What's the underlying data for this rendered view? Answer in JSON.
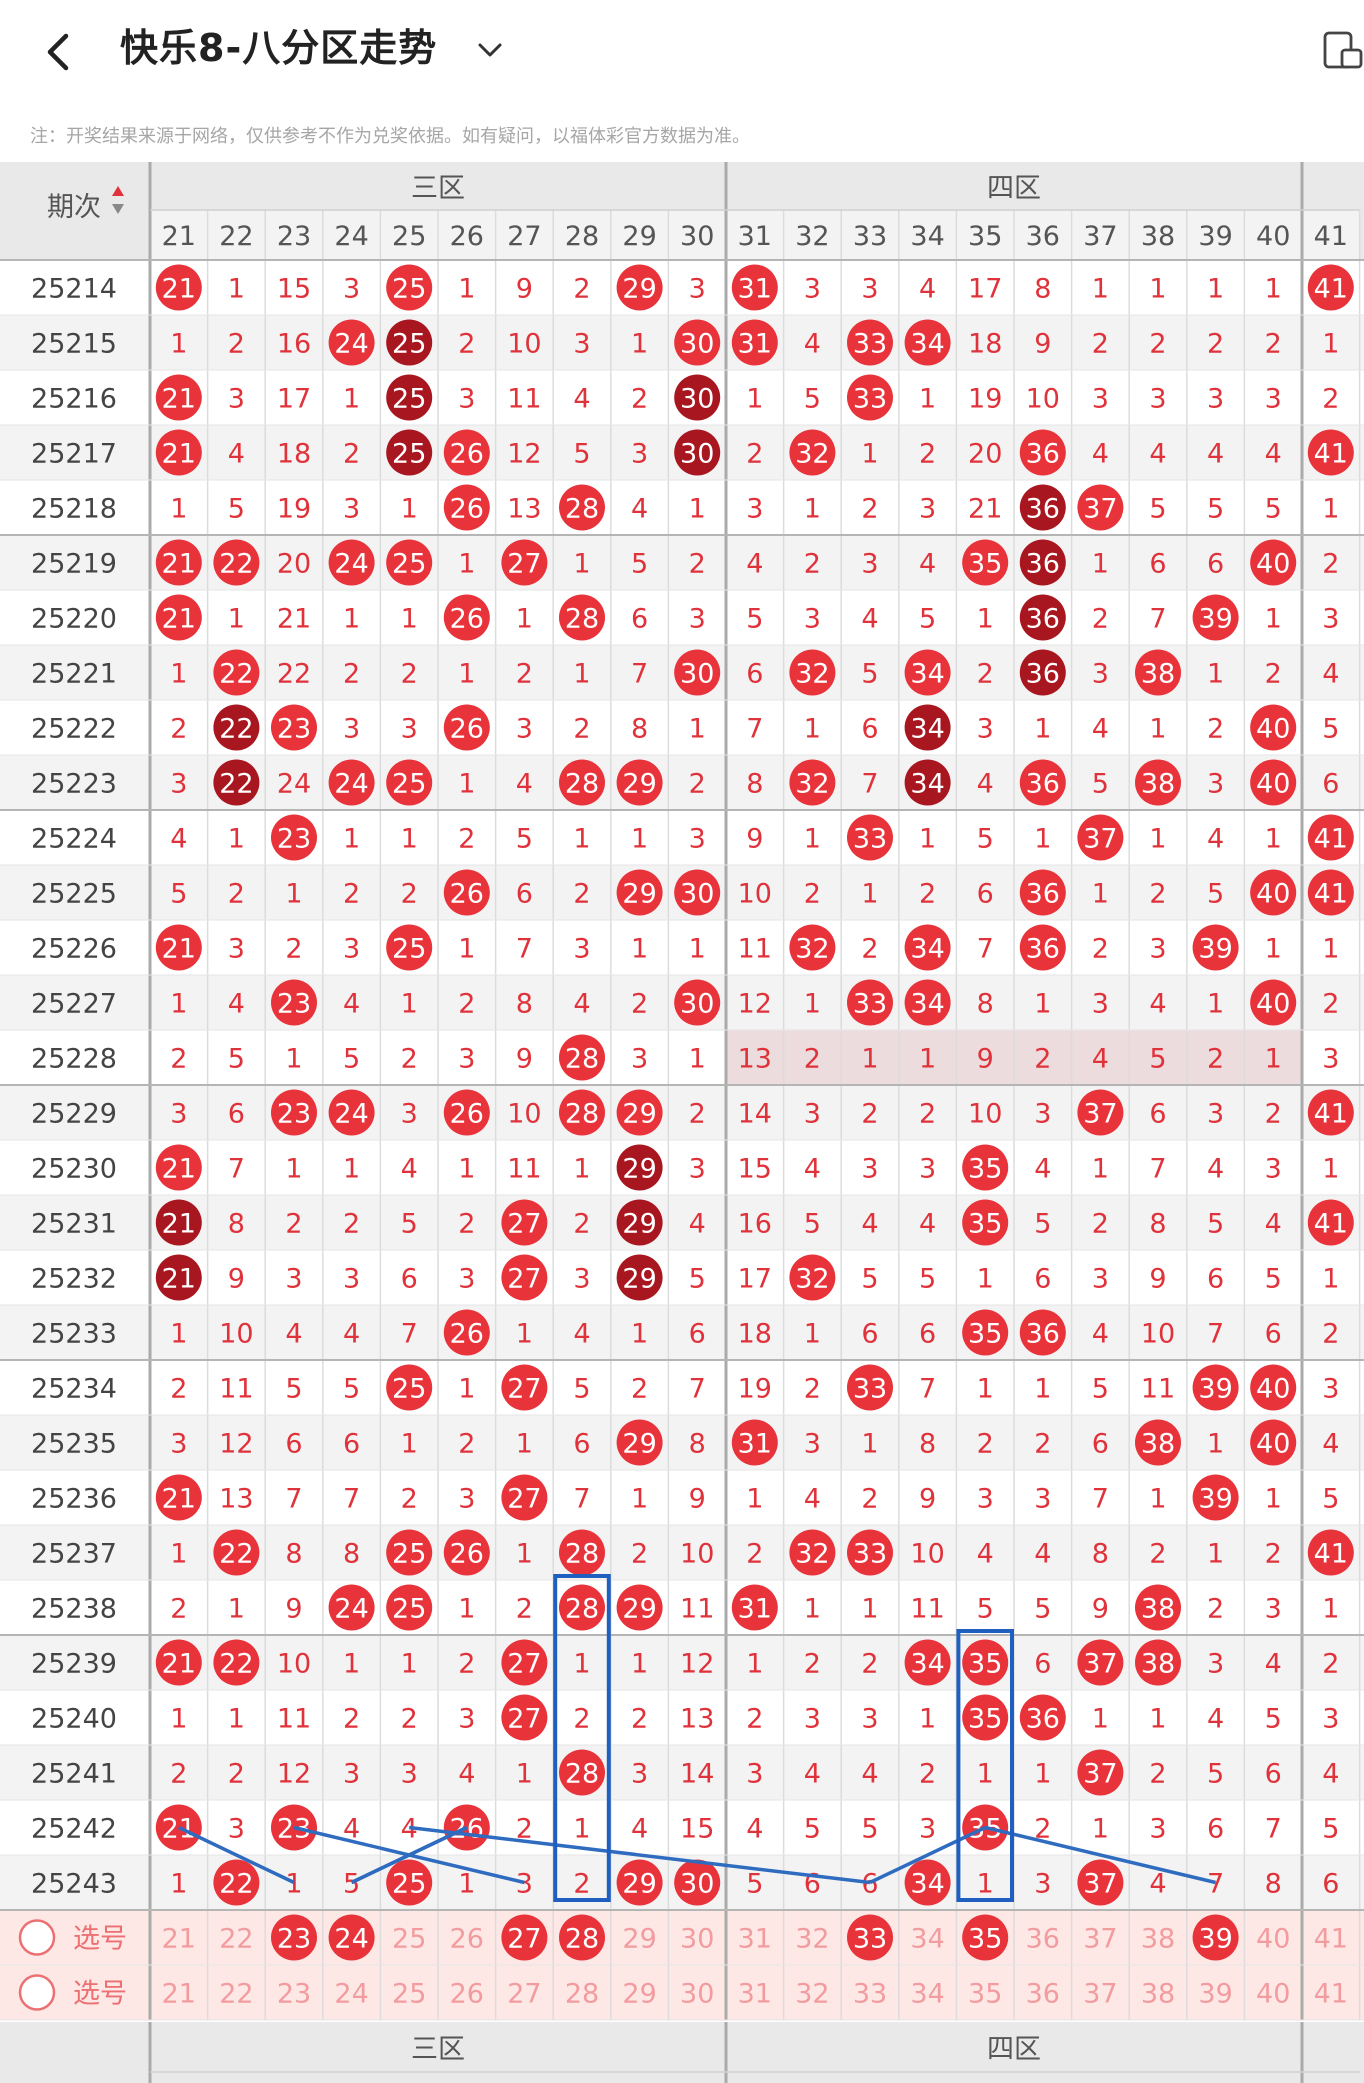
{
  "header": {
    "title": "快乐8-八分区走势",
    "note": "注：开奖结果来源于网络，仅供参考不作为兑奖依据。如有疑问，以福体彩官方数据为准。"
  },
  "table": {
    "issue_label": "期次",
    "zones": [
      {
        "name": "三区",
        "first": 21,
        "last": 30
      },
      {
        "name": "四区",
        "first": 31,
        "last": 40
      }
    ],
    "columns": [
      "21",
      "22",
      "23",
      "24",
      "25",
      "26",
      "27",
      "28",
      "29",
      "30",
      "31",
      "32",
      "33",
      "34",
      "35",
      "36",
      "37",
      "38",
      "39",
      "40",
      "41"
    ],
    "rows": [
      {
        "issue": "25214",
        "cells": [
          "21",
          "1",
          "15",
          "3",
          "25",
          "1",
          "9",
          "2",
          "29",
          "3",
          "31",
          "3",
          "3",
          "4",
          "17",
          "8",
          "1",
          "1",
          "1",
          "1",
          "41"
        ]
      },
      {
        "issue": "25215",
        "cells": [
          "1",
          "2",
          "16",
          "24",
          "25",
          "2",
          "10",
          "3",
          "1",
          "30",
          "31",
          "4",
          "33",
          "34",
          "18",
          "9",
          "2",
          "2",
          "2",
          "2",
          "1"
        ]
      },
      {
        "issue": "25216",
        "cells": [
          "21",
          "3",
          "17",
          "1",
          "25",
          "3",
          "11",
          "4",
          "2",
          "30",
          "1",
          "5",
          "33",
          "1",
          "19",
          "10",
          "3",
          "3",
          "3",
          "3",
          "2"
        ]
      },
      {
        "issue": "25217",
        "cells": [
          "21",
          "4",
          "18",
          "2",
          "25",
          "26",
          "12",
          "5",
          "3",
          "30",
          "2",
          "32",
          "1",
          "2",
          "20",
          "36",
          "4",
          "4",
          "4",
          "4",
          "41"
        ]
      },
      {
        "issue": "25218",
        "cells": [
          "1",
          "5",
          "19",
          "3",
          "1",
          "26",
          "13",
          "28",
          "4",
          "1",
          "3",
          "1",
          "2",
          "3",
          "21",
          "36",
          "37",
          "5",
          "5",
          "5",
          "1"
        ]
      },
      {
        "issue": "25219",
        "cells": [
          "21",
          "22",
          "20",
          "24",
          "25",
          "1",
          "27",
          "1",
          "5",
          "2",
          "4",
          "2",
          "3",
          "4",
          "35",
          "36",
          "1",
          "6",
          "6",
          "40",
          "2"
        ]
      },
      {
        "issue": "25220",
        "cells": [
          "21",
          "1",
          "21",
          "1",
          "1",
          "26",
          "1",
          "28",
          "6",
          "3",
          "5",
          "3",
          "4",
          "5",
          "1",
          "36",
          "2",
          "7",
          "39",
          "1",
          "3"
        ]
      },
      {
        "issue": "25221",
        "cells": [
          "1",
          "22",
          "22",
          "2",
          "2",
          "1",
          "2",
          "1",
          "7",
          "30",
          "6",
          "32",
          "5",
          "34",
          "2",
          "36",
          "3",
          "38",
          "1",
          "2",
          "4"
        ]
      },
      {
        "issue": "25222",
        "cells": [
          "2",
          "22",
          "23",
          "3",
          "3",
          "26",
          "3",
          "2",
          "8",
          "1",
          "7",
          "1",
          "6",
          "34",
          "3",
          "1",
          "4",
          "1",
          "2",
          "40",
          "5"
        ]
      },
      {
        "issue": "25223",
        "cells": [
          "3",
          "22",
          "24",
          "24",
          "25",
          "1",
          "4",
          "28",
          "29",
          "2",
          "8",
          "32",
          "7",
          "34",
          "4",
          "36",
          "5",
          "38",
          "3",
          "40",
          "6"
        ]
      },
      {
        "issue": "25224",
        "cells": [
          "4",
          "1",
          "23",
          "1",
          "1",
          "2",
          "5",
          "1",
          "1",
          "3",
          "9",
          "1",
          "33",
          "1",
          "5",
          "1",
          "37",
          "1",
          "4",
          "1",
          "41"
        ]
      },
      {
        "issue": "25225",
        "cells": [
          "5",
          "2",
          "1",
          "2",
          "2",
          "26",
          "6",
          "2",
          "29",
          "30",
          "10",
          "2",
          "1",
          "2",
          "6",
          "36",
          "1",
          "2",
          "5",
          "40",
          "41"
        ]
      },
      {
        "issue": "25226",
        "cells": [
          "21",
          "3",
          "2",
          "3",
          "25",
          "1",
          "7",
          "3",
          "1",
          "1",
          "11",
          "32",
          "2",
          "34",
          "7",
          "36",
          "2",
          "3",
          "39",
          "1",
          "1"
        ]
      },
      {
        "issue": "25227",
        "cells": [
          "1",
          "4",
          "23",
          "4",
          "1",
          "2",
          "8",
          "4",
          "2",
          "30",
          "12",
          "1",
          "33",
          "34",
          "8",
          "1",
          "3",
          "4",
          "1",
          "40",
          "2"
        ]
      },
      {
        "issue": "25228",
        "cells": [
          "2",
          "5",
          "1",
          "5",
          "2",
          "3",
          "9",
          "28",
          "3",
          "1",
          "13",
          "2",
          "1",
          "1",
          "9",
          "2",
          "4",
          "5",
          "2",
          "1",
          "3"
        ]
      },
      {
        "issue": "25229",
        "cells": [
          "3",
          "6",
          "23",
          "24",
          "3",
          "26",
          "10",
          "28",
          "29",
          "2",
          "14",
          "3",
          "2",
          "2",
          "10",
          "3",
          "37",
          "6",
          "3",
          "2",
          "41"
        ]
      },
      {
        "issue": "25230",
        "cells": [
          "21",
          "7",
          "1",
          "1",
          "4",
          "1",
          "11",
          "1",
          "29",
          "3",
          "15",
          "4",
          "3",
          "3",
          "35",
          "4",
          "1",
          "7",
          "4",
          "3",
          "1"
        ]
      },
      {
        "issue": "25231",
        "cells": [
          "21",
          "8",
          "2",
          "2",
          "5",
          "2",
          "27",
          "2",
          "29",
          "4",
          "16",
          "5",
          "4",
          "4",
          "35",
          "5",
          "2",
          "8",
          "5",
          "4",
          "41"
        ]
      },
      {
        "issue": "25232",
        "cells": [
          "21",
          "9",
          "3",
          "3",
          "6",
          "3",
          "27",
          "3",
          "29",
          "5",
          "17",
          "32",
          "5",
          "5",
          "1",
          "6",
          "3",
          "9",
          "6",
          "5",
          "1"
        ]
      },
      {
        "issue": "25233",
        "cells": [
          "1",
          "10",
          "4",
          "4",
          "7",
          "26",
          "1",
          "4",
          "1",
          "6",
          "18",
          "1",
          "6",
          "6",
          "35",
          "36",
          "4",
          "10",
          "7",
          "6",
          "2"
        ]
      },
      {
        "issue": "25234",
        "cells": [
          "2",
          "11",
          "5",
          "5",
          "25",
          "1",
          "27",
          "5",
          "2",
          "7",
          "19",
          "2",
          "33",
          "7",
          "1",
          "1",
          "5",
          "11",
          "39",
          "40",
          "3"
        ]
      },
      {
        "issue": "25235",
        "cells": [
          "3",
          "12",
          "6",
          "6",
          "1",
          "2",
          "1",
          "6",
          "29",
          "8",
          "31",
          "3",
          "1",
          "8",
          "2",
          "2",
          "6",
          "38",
          "1",
          "40",
          "4"
        ]
      },
      {
        "issue": "25236",
        "cells": [
          "21",
          "13",
          "7",
          "7",
          "2",
          "3",
          "27",
          "7",
          "1",
          "9",
          "1",
          "4",
          "2",
          "9",
          "3",
          "3",
          "7",
          "1",
          "39",
          "1",
          "5"
        ]
      },
      {
        "issue": "25237",
        "cells": [
          "1",
          "22",
          "8",
          "8",
          "25",
          "26",
          "1",
          "28",
          "2",
          "10",
          "2",
          "32",
          "33",
          "10",
          "4",
          "4",
          "8",
          "2",
          "1",
          "2",
          "41"
        ]
      },
      {
        "issue": "25238",
        "cells": [
          "2",
          "1",
          "9",
          "24",
          "25",
          "1",
          "2",
          "28",
          "29",
          "11",
          "31",
          "1",
          "1",
          "11",
          "5",
          "5",
          "9",
          "38",
          "2",
          "3",
          "1"
        ]
      },
      {
        "issue": "25239",
        "cells": [
          "21",
          "22",
          "10",
          "1",
          "1",
          "2",
          "27",
          "1",
          "1",
          "12",
          "1",
          "2",
          "2",
          "34",
          "35",
          "6",
          "37",
          "38",
          "3",
          "4",
          "2"
        ]
      },
      {
        "issue": "25240",
        "cells": [
          "1",
          "1",
          "11",
          "2",
          "2",
          "3",
          "27",
          "2",
          "2",
          "13",
          "2",
          "3",
          "3",
          "1",
          "35",
          "36",
          "1",
          "1",
          "4",
          "5",
          "3"
        ]
      },
      {
        "issue": "25241",
        "cells": [
          "2",
          "2",
          "12",
          "3",
          "3",
          "4",
          "1",
          "28",
          "3",
          "14",
          "3",
          "4",
          "4",
          "2",
          "1",
          "1",
          "37",
          "2",
          "5",
          "6",
          "4"
        ]
      },
      {
        "issue": "25242",
        "cells": [
          "21",
          "3",
          "23",
          "4",
          "4",
          "26",
          "2",
          "1",
          "4",
          "15",
          "4",
          "5",
          "5",
          "3",
          "35",
          "2",
          "1",
          "3",
          "6",
          "7",
          "5"
        ]
      },
      {
        "issue": "25243",
        "cells": [
          "1",
          "22",
          "1",
          "5",
          "25",
          "1",
          "3",
          "2",
          "29",
          "30",
          "5",
          "6",
          "6",
          "34",
          "1",
          "3",
          "37",
          "4",
          "7",
          "8",
          "6"
        ]
      }
    ],
    "select_rows": [
      {
        "label": "选号",
        "selected": [
          "23",
          "24",
          "27",
          "28",
          "33",
          "35",
          "39"
        ]
      },
      {
        "label": "选号",
        "selected": []
      }
    ]
  },
  "colors": {
    "hit": "#e8333a",
    "repeat": "#a8161f",
    "number": "#e0323a",
    "select_num": "#f29c9f",
    "line": "#2f6cc0",
    "box": "#1f5fbf"
  }
}
